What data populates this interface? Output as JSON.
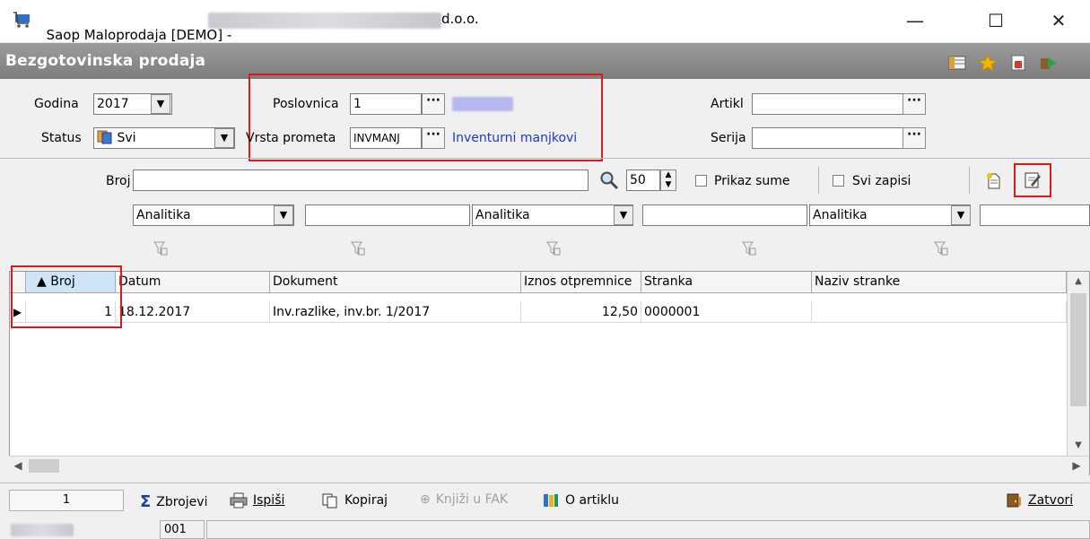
{
  "window": {
    "title_prefix": "Saop Maloprodaja [DEMO] -",
    "title_suffix": "d.o.o."
  },
  "module": {
    "title": "Bezgotovinska prodaja"
  },
  "filters": {
    "godina_label": "Godina",
    "godina_value": "2017",
    "status_label": "Status",
    "status_value": "Svi",
    "poslovnica_label": "Poslovnica",
    "poslovnica_value": "1",
    "vrsta_label": "Vrsta prometa",
    "vrsta_value": "INVMANJ",
    "vrsta_desc": "Inventurni manjkovi",
    "artikl_label": "Artikl",
    "artikl_value": "",
    "serija_label": "Serija",
    "serija_value": "",
    "dots": "···"
  },
  "search": {
    "broj_label": "Broj",
    "broj_value": "",
    "page_size": "50",
    "prikaz_sume": "Prikaz sume",
    "svi_zapisi": "Svi zapisi",
    "analitika": [
      "Analitika",
      "Analitika",
      "Analitika"
    ]
  },
  "grid": {
    "columns": [
      "▲ Broj",
      "Datum",
      "Dokument",
      "Iznos otpremnice",
      "Stranka",
      "Naziv stranke"
    ],
    "rows": [
      {
        "broj": "1",
        "datum": "18.12.2017",
        "dokument": "Inv.razlike, inv.br. 1/2017",
        "iznos": "12,50",
        "stranka": "0000001",
        "naziv": ""
      }
    ]
  },
  "toolbar": {
    "count": "1",
    "zbrojevi": "Zbrojevi",
    "ispisi": "Ispiši",
    "kopiraj": "Kopiraj",
    "knjizi": "Knjiži u FAK",
    "o_artiklu": "O artiklu",
    "zatvori": "Zatvori"
  },
  "status": {
    "code": "001"
  },
  "colors": {
    "highlight_box": "#d81b1b",
    "link": "#1f36c8",
    "module_bar": "#8a8a8a"
  }
}
